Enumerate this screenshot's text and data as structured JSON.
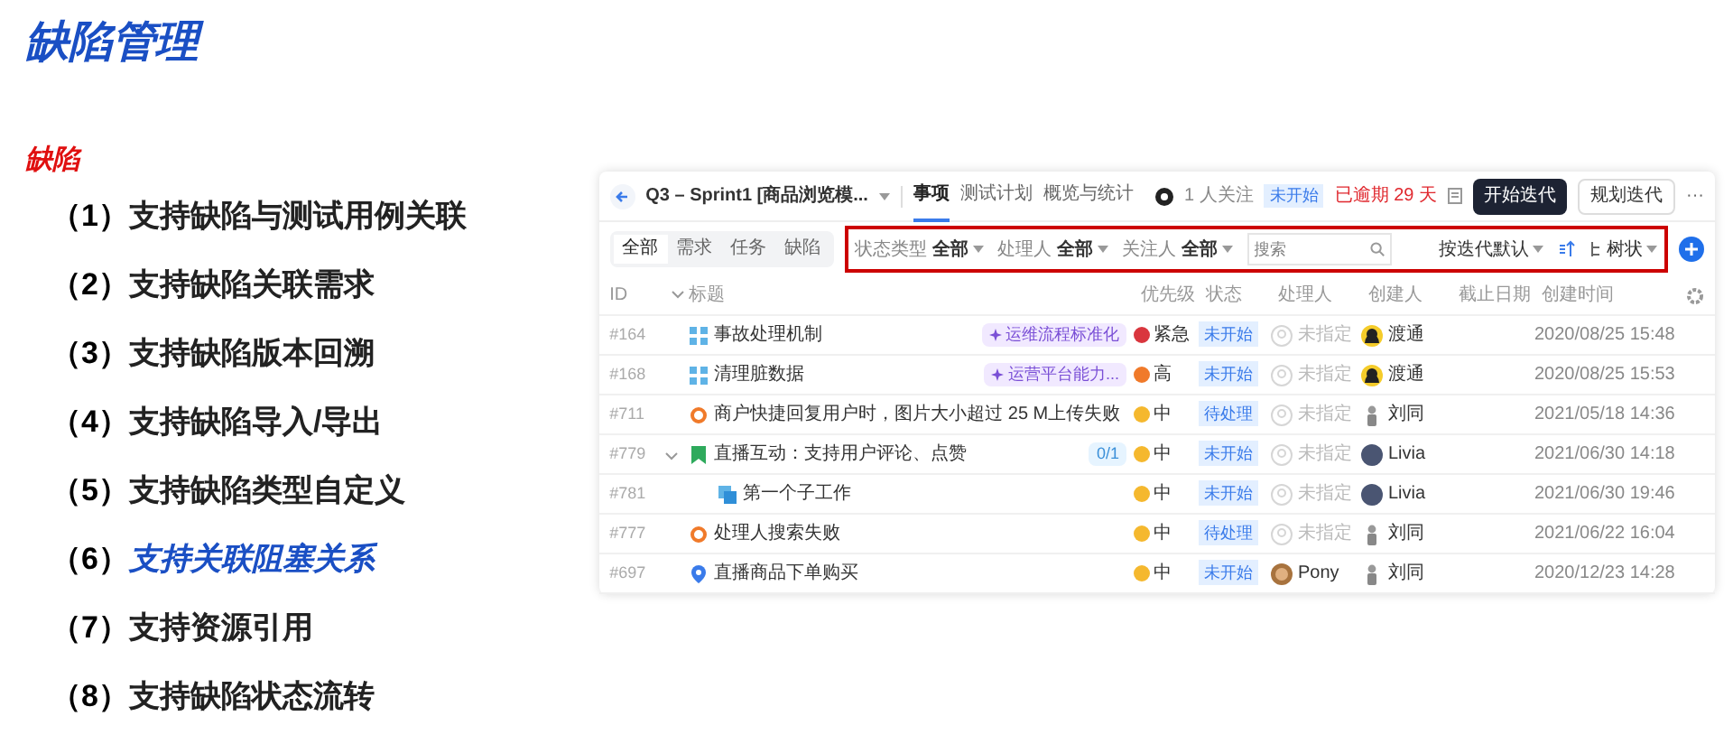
{
  "slide": {
    "title": "缺陷管理",
    "section": "缺陷",
    "items": [
      {
        "number": "（1）",
        "text": "支持缺陷与测试用例关联",
        "highlight": false
      },
      {
        "number": "（2）",
        "text": "支持缺陷关联需求",
        "highlight": false
      },
      {
        "number": "（3）",
        "text": "支持缺陷版本回溯",
        "highlight": false
      },
      {
        "number": "（4）",
        "text": "支持缺陷导入/导出",
        "highlight": false
      },
      {
        "number": "（5）",
        "text": "支持缺陷类型自定义",
        "highlight": false
      },
      {
        "number": "（6）",
        "text": "支持关联阻塞关系",
        "highlight": true
      },
      {
        "number": "（7）",
        "text": "支持资源引用",
        "highlight": false
      },
      {
        "number": "（8）",
        "text": "支持缺陷状态流转",
        "highlight": false
      }
    ]
  },
  "app": {
    "sprint": "Q3 – Sprint1 [商品浏览模...",
    "tabs": [
      {
        "label": "事项",
        "selected": true
      },
      {
        "label": "测试计划",
        "selected": false
      },
      {
        "label": "概览与统计",
        "selected": false
      }
    ],
    "followers": "1 人关注",
    "status": "未开始",
    "overdue": "已逾期 29 天",
    "buttons": [
      {
        "label": "开始迭代",
        "primary": true
      },
      {
        "label": "规划迭代",
        "primary": false
      }
    ],
    "more": "···",
    "segments": [
      {
        "label": "全部",
        "selected": true
      },
      {
        "label": "需求",
        "selected": false
      },
      {
        "label": "任务",
        "selected": false
      },
      {
        "label": "缺陷",
        "selected": false
      }
    ],
    "filters": [
      {
        "label": "状态类型",
        "value": "全部"
      },
      {
        "label": "处理人",
        "value": "全部"
      },
      {
        "label": "关注人",
        "value": "全部"
      }
    ],
    "search": {
      "placeholder": "搜索"
    },
    "sort": "按迭代默认",
    "view": "树状",
    "columns": [
      "ID",
      "标题",
      "优先级",
      "状态",
      "处理人",
      "创建人",
      "截止日期",
      "创建时间"
    ],
    "rows": [
      {
        "id": "#164",
        "kind": "epic",
        "title": "事故处理机制",
        "tag": {
          "kind": "goal",
          "text": "运维流程标准化"
        },
        "priority": {
          "text": "紧急",
          "color": "#d9363e"
        },
        "status": "未开始",
        "assignee": {
          "kind": "empty",
          "name": "未指定"
        },
        "creator": {
          "kind": "yellow",
          "name": "渡通"
        },
        "created": "2020/08/25 15:48"
      },
      {
        "id": "#168",
        "kind": "epic",
        "title": "清理脏数据",
        "tag": {
          "kind": "goal",
          "text": "运营平台能力..."
        },
        "priority": {
          "text": "高",
          "color": "#f07a2a"
        },
        "status": "未开始",
        "assignee": {
          "kind": "empty",
          "name": "未指定"
        },
        "creator": {
          "kind": "yellow",
          "name": "渡通"
        },
        "created": "2020/08/25 15:53"
      },
      {
        "id": "#711",
        "kind": "bug",
        "title": "商户快捷回复用户时，图片大小超过 25 M上传失败",
        "priority": {
          "text": "中",
          "color": "#f5b82e"
        },
        "status": "待处理",
        "assignee": {
          "kind": "empty",
          "name": "未指定"
        },
        "creator": {
          "kind": "figure",
          "name": "刘同"
        },
        "created": "2021/05/18 14:36"
      },
      {
        "id": "#779",
        "kind": "story",
        "title": "直播互动：支持用户评论、点赞",
        "expanded": true,
        "tag": {
          "kind": "subtasks",
          "text": "0/1"
        },
        "priority": {
          "text": "中",
          "color": "#f5b82e"
        },
        "status": "未开始",
        "assignee": {
          "kind": "empty",
          "name": "未指定"
        },
        "creator": {
          "kind": "dark",
          "name": "Livia"
        },
        "created": "2021/06/30 14:18",
        "children": [
          {
            "id": "#781",
            "kind": "subtask",
            "title": "第一个子工作",
            "priority": {
              "text": "中",
              "color": "#f5b82e"
            },
            "status": "未开始",
            "assignee": {
              "kind": "empty",
              "name": "未指定"
            },
            "creator": {
              "kind": "dark",
              "name": "Livia"
            },
            "created": "2021/06/30 19:46"
          }
        ]
      },
      {
        "id": "#777",
        "kind": "bug",
        "title": "处理人搜索失败",
        "priority": {
          "text": "中",
          "color": "#f5b82e"
        },
        "status": "待处理",
        "assignee": {
          "kind": "empty",
          "name": "未指定"
        },
        "creator": {
          "kind": "figure",
          "name": "刘同"
        },
        "created": "2021/06/22 16:04"
      },
      {
        "id": "#697",
        "kind": "pin",
        "title": "直播商品下单购买",
        "priority": {
          "text": "中",
          "color": "#f5b82e"
        },
        "status": "未开始",
        "assignee": {
          "kind": "brown",
          "name": "Pony"
        },
        "creator": {
          "kind": "figure",
          "name": "刘同"
        },
        "created": "2020/12/23 14:28"
      }
    ]
  }
}
